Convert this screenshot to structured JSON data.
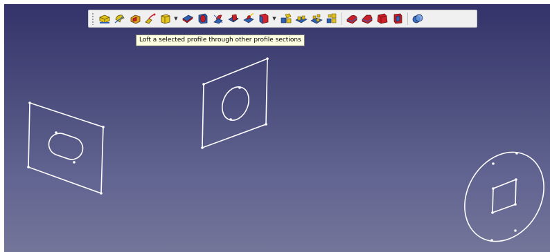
{
  "tooltip": {
    "text": "Loft a selected profile through other profile sections"
  },
  "toolbar": {
    "buttons": [
      {
        "name": "pad-icon",
        "color": "#e3c318"
      },
      {
        "name": "revolution-icon",
        "color": "#d9c21c"
      },
      {
        "name": "additive-loft-icon",
        "color": "#e0a020"
      },
      {
        "name": "additive-pipe-icon",
        "color": "#d8b81a"
      },
      {
        "name": "additive-primitive-icon",
        "color": "#e5c51c"
      },
      {
        "name": "pocket-icon",
        "color": "#c9202a"
      },
      {
        "name": "hole-icon",
        "color": "#c41e28"
      },
      {
        "name": "groove-icon",
        "color": "#cc2430"
      },
      {
        "name": "subtractive-loft-icon",
        "color": "#c82028"
      },
      {
        "name": "subtractive-pipe-icon",
        "color": "#c41c26"
      },
      {
        "name": "subtractive-primitive-icon",
        "color": "#d02530"
      },
      {
        "name": "mirrored-icon",
        "color": "#e2c21a"
      },
      {
        "name": "linear-pattern-icon",
        "color": "#dcbc1c"
      },
      {
        "name": "polar-pattern-icon",
        "color": "#d6b61a"
      },
      {
        "name": "multitransform-icon",
        "color": "#e0c01c"
      },
      {
        "name": "fillet-icon",
        "color": "#c81e28"
      },
      {
        "name": "chamfer-icon",
        "color": "#c62028"
      },
      {
        "name": "draft-icon",
        "color": "#cc2028"
      },
      {
        "name": "thickness-icon",
        "color": "#c21c26"
      },
      {
        "name": "boolean-icon",
        "color": "#3d6fc0"
      }
    ]
  }
}
